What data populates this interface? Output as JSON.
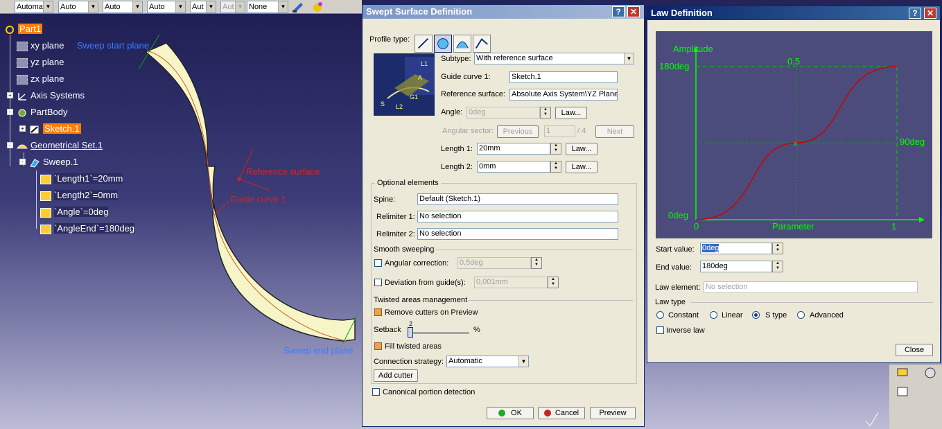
{
  "toolbar": {
    "combos": [
      {
        "value": "Automa",
        "disabled": false
      },
      {
        "value": "Auto",
        "disabled": false
      },
      {
        "value": "Auto",
        "disabled": false
      },
      {
        "value": "Auto",
        "disabled": false
      },
      {
        "value": "Aut",
        "disabled": false
      },
      {
        "value": "Aut",
        "disabled": true
      },
      {
        "value": "None",
        "disabled": false
      }
    ]
  },
  "tree": {
    "part": "Part1",
    "xy": "xy plane",
    "yz": "yz plane",
    "zx": "zx plane",
    "axis": "Axis Systems",
    "body": "PartBody",
    "sketch": "Sketch.1",
    "geoset": "Geometrical Set.1",
    "sweep": "Sweep.1",
    "params": [
      "`Length1`=20mm",
      "`Length2`=0mm",
      "`Angle`=0deg",
      "`AngleEnd`=180deg"
    ]
  },
  "viewport_labels": {
    "sweep_start": "Sweep start plane",
    "sweep_end": "Sweep end plane",
    "reference_surface": "Reference surface",
    "guide_curve": "Guide curve 1"
  },
  "swept": {
    "title": "Swept Surface Definition",
    "profile_type_label": "Profile type:",
    "subtype_label": "Subtype:",
    "subtype_value": "With reference surface",
    "guide_label": "Guide curve 1:",
    "guide_value": "Sketch.1",
    "ref_label": "Reference surface:",
    "ref_value": "Absolute Axis System\\YZ Plane",
    "angle_label": "Angle:",
    "angle_value": "0deg",
    "law_btn": "Law...",
    "angular_sector_label": "Angular sector:",
    "previous_btn": "Previous",
    "sector_value": "1",
    "sector_total": "/ 4",
    "next_btn": "Next",
    "length1_label": "Length 1:",
    "length1_value": "20mm",
    "length2_label": "Length 2:",
    "length2_value": "0mm",
    "optional_label": "Optional elements",
    "spine_label": "Spine:",
    "spine_value": "Default (Sketch.1)",
    "relim1_label": "Relimiter 1:",
    "relim1_value": "No selection",
    "relim2_label": "Relimiter 2:",
    "relim2_value": "No selection",
    "smooth_label": "Smooth sweeping",
    "angular_correction_label": "Angular correction:",
    "angular_correction_value": "0,5deg",
    "deviation_label": "Deviation from guide(s):",
    "deviation_value": "0,001mm",
    "twisted_label": "Twisted areas management",
    "remove_cutters_label": "Remove cutters on Preview",
    "setback_label": "Setback",
    "setback_value": "2",
    "setback_unit": "%",
    "fill_twisted_label": "Fill twisted areas",
    "connection_label": "Connection strategy:",
    "connection_value": "Automatic",
    "add_cutter_btn": "Add cutter",
    "canonical_label": "Canonical portion detection",
    "ok_btn": "OK",
    "cancel_btn": "Cancel",
    "preview_btn": "Preview",
    "diagram_labels": [
      "L1",
      "A",
      "S",
      "L2",
      "G1"
    ]
  },
  "law": {
    "title": "Law Definition",
    "graph": {
      "amplitude": "Amplitude",
      "y_top": "180deg",
      "y_mid": "90deg",
      "y_bottom": "0deg",
      "x_mid": "0,5",
      "x_zero": "0",
      "x_one": "1",
      "x_label": "Parameter"
    },
    "start_label": "Start value:",
    "start_value": "0deg",
    "end_label": "End value:",
    "end_value": "180deg",
    "law_element_label": "Law element:",
    "law_element_value": "No selection",
    "law_type_label": "Law type",
    "constant": "Constant",
    "linear": "Linear",
    "stype": "S type",
    "advanced": "Advanced",
    "inverse_label": "Inverse law",
    "close_btn": "Close"
  },
  "colors": {
    "graph_bg": "#4c4c7c",
    "axis_green": "#00ff00",
    "curve_red": "#cc0000",
    "highlight_orange": "#ff7e00"
  }
}
